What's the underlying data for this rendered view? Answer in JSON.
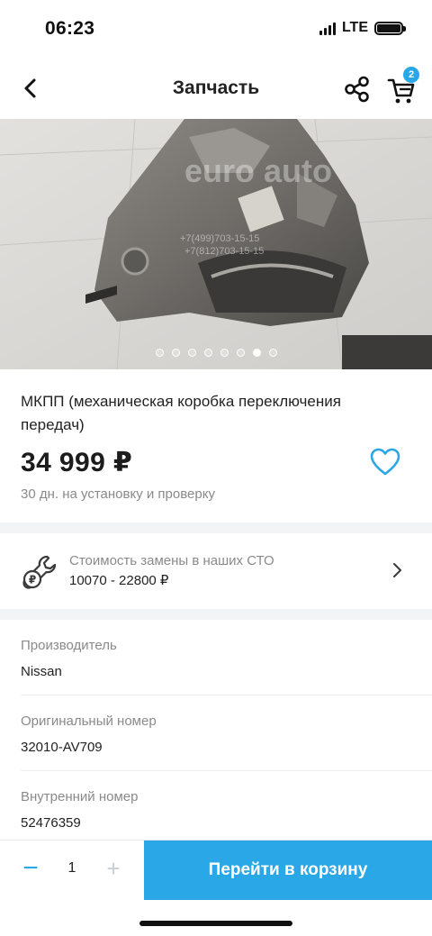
{
  "status_bar": {
    "time": "06:23",
    "network": "LTE"
  },
  "nav": {
    "title": "Запчасть",
    "cart_count": "2"
  },
  "gallery": {
    "watermark_brand": "euro auto",
    "watermark_phone_1": "+7(499)703-15-15",
    "watermark_phone_2": "+7(812)703-15-15",
    "slides_total": 8,
    "active_slide": 7
  },
  "product": {
    "title": "МКПП (механическая коробка переключения передач)",
    "price": "34 999 ₽",
    "install_note": "30 дн. на установку и проверку"
  },
  "service": {
    "label": "Стоимость замены в наших СТО",
    "value": "10070 - 22800 ₽"
  },
  "specs": [
    {
      "label": "Производитель",
      "value": "Nissan"
    },
    {
      "label": "Оригинальный номер",
      "value": "32010-AV709"
    },
    {
      "label": "Внутренний номер",
      "value": "52476359"
    }
  ],
  "bottom_bar": {
    "minus": "−",
    "quantity": "1",
    "plus": "+",
    "cta_label": "Перейти в корзину"
  },
  "colors": {
    "accent": "#2aa7e6",
    "muted_text": "#8a8a8a",
    "band": "#f2f4f6"
  }
}
